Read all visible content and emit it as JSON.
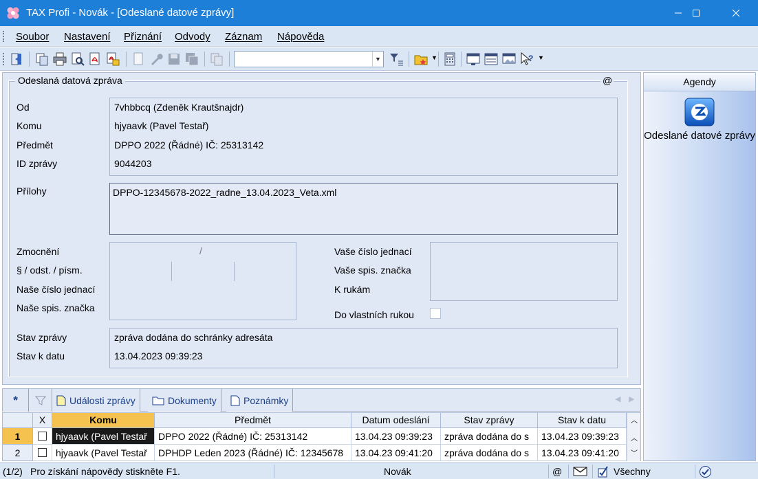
{
  "window": {
    "title": "TAX Profi - Novák - [Odeslané datové zprávy]",
    "minimize_icon": "minimize-icon",
    "maximize_icon": "maximize-icon",
    "close_icon": "close-icon"
  },
  "menu": {
    "items": [
      "Soubor",
      "Nastavení",
      "Přiznání",
      "Odvody",
      "Záznam",
      "Nápověda"
    ]
  },
  "toolbar": {
    "combo_value": "",
    "icons": [
      "exit-icon",
      "copy-icon",
      "print-icon",
      "preview-icon",
      "pdf-icon",
      "pdf-send-icon",
      "new-doc-icon",
      "wrench-icon",
      "save-icon",
      "save-all-icon",
      "paste-icon",
      "filter-icon",
      "folder-star-icon",
      "calculator-icon",
      "window-icon",
      "form-icon",
      "screen-icon",
      "help-icon"
    ]
  },
  "message": {
    "group_title": "Odeslaná datová zpráva",
    "at_symbol": "@",
    "labels": {
      "from": "Od",
      "to": "Komu",
      "subject": "Předmět",
      "id": "ID zprávy",
      "attachments": "Přílohy",
      "authorization": "Zmocnění",
      "paragraph": "§ / odst. / písm.",
      "our_ref": "Naše číslo jednací",
      "our_file": "Naše spis. značka",
      "your_ref": "Vaše číslo jednací",
      "your_file": "Vaše spis. značka",
      "attention": "K rukám",
      "personal": "Do vlastních rukou",
      "state": "Stav zprávy",
      "state_date": "Stav k datu"
    },
    "values": {
      "from": "7vhbbcq (Zdeněk Krautšnajdr)",
      "to": "hjyaavk (Pavel Testař)",
      "subject": "DPPO 2022 (Řádné) IČ: 25313142",
      "id": "9044203",
      "attachments": "DPPO-12345678-2022_radne_13.04.2023_Veta.xml",
      "authorization_sep": "/",
      "state": "zpráva dodána do schránky adresáta",
      "state_date": "13.04.2023 09:39:23"
    }
  },
  "tabs": {
    "items": [
      {
        "label": "",
        "icon": "asterisk-icon"
      },
      {
        "label": "",
        "icon": "filter-icon"
      },
      {
        "label": "Události zprávy",
        "icon": "page-icon"
      },
      {
        "label": "Dokumenty",
        "icon": "folder-icon"
      },
      {
        "label": "Poznámky",
        "icon": "page-icon"
      }
    ],
    "asterisk": "*"
  },
  "table": {
    "headers": [
      "X",
      "Komu",
      "Předmět",
      "Datum odeslání",
      "Stav zprávy",
      "Stav k datu"
    ],
    "rows": [
      {
        "num": "1",
        "to": "hjyaavk (Pavel Testař",
        "subject": "DPPO 2022 (Řádné) IČ: 25313142",
        "sent": "13.04.23 09:39:23",
        "state": "zpráva dodána do s",
        "state_date": "13.04.23 09:39:23"
      },
      {
        "num": "2",
        "to": "hjyaavk (Pavel Testař",
        "subject": "DPHDP Leden 2023 (Řádné) IČ: 12345678",
        "sent": "13.04.23 09:41:20",
        "state": "zpráva dodána do s",
        "state_date": "13.04.23 09:41:20"
      }
    ]
  },
  "agendy": {
    "header": "Agendy",
    "item_label": "Odeslané datové zprávy"
  },
  "status": {
    "position": "(1/2)",
    "help": "Pro získání nápovědy stiskněte F1.",
    "user": "Novák",
    "at": "@",
    "filter": "Všechny"
  },
  "colors": {
    "titlebar": "#1e7fd8",
    "panel": "#e0e8f5",
    "selected_header": "#f6c24f",
    "selected_cell": "#1a1a1a"
  }
}
